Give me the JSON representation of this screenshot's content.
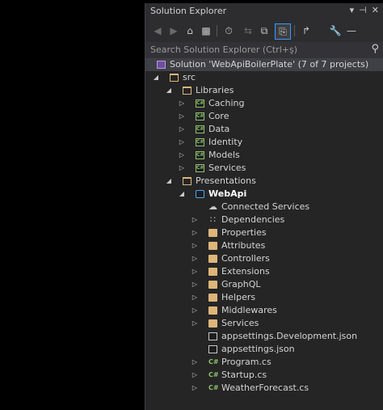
{
  "window": {
    "title": "Solution Explorer",
    "pin_glyph": "▾",
    "auto_hide_glyph": "⊣",
    "close_glyph": "✕"
  },
  "toolbar": {
    "back_icon": "back-arrow-icon",
    "forward_icon": "forward-arrow-icon",
    "home_icon": "home-icon",
    "switch_views_icon": "switch-views-icon",
    "pending_changes_icon": "history-icon",
    "sync_icon": "sync-icon",
    "collapse_all_icon": "collapse-all-icon",
    "show_all_files_icon": "show-all-files-icon",
    "preview_icon": "preview-icon",
    "properties_icon": "wrench-icon",
    "dash_glyph": "—"
  },
  "search": {
    "placeholder": "Search Solution Explorer (Ctrl+ş)"
  },
  "tree": {
    "solution": "Solution 'WebApiBoilerPlate' (7 of 7 projects)",
    "src": "src",
    "libraries": "Libraries",
    "library_projects": [
      "Caching",
      "Core",
      "Data",
      "Identity",
      "Models",
      "Services"
    ],
    "presentations": "Presentations",
    "webapi": "WebApi",
    "connected_services": "Connected Services",
    "dependencies": "Dependencies",
    "properties": "Properties",
    "folders": [
      "Attributes",
      "Controllers",
      "Extensions",
      "GraphQL",
      "Helpers",
      "Middlewares",
      "Services"
    ],
    "json_files": [
      "appsettings.Development.json",
      "appsettings.json"
    ],
    "cs_files": [
      "Program.cs",
      "Startup.cs",
      "WeatherForecast.cs"
    ]
  },
  "colors": {
    "panel_bg": "#252526",
    "folder": "#dcb67a",
    "csharp": "#8cc26a",
    "accent": "#3399ff"
  }
}
